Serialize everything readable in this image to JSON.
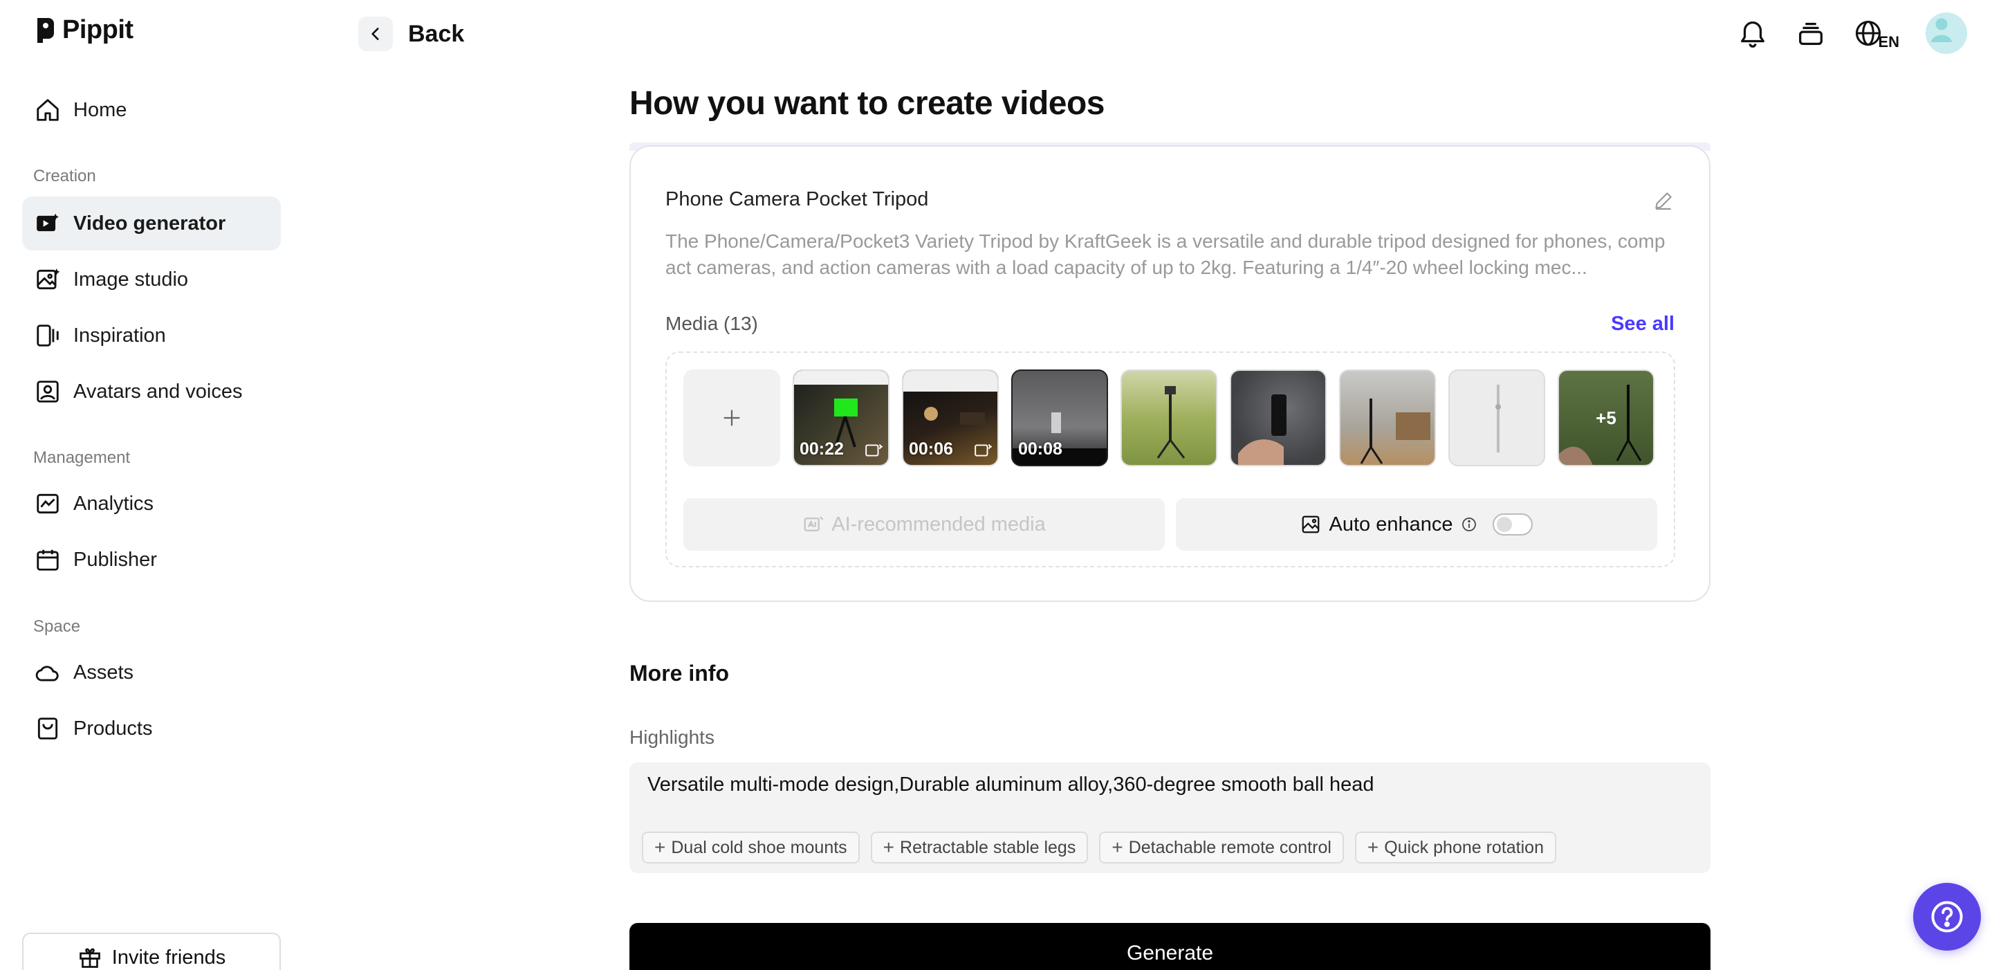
{
  "brand": {
    "name": "Pippit"
  },
  "sidebar": {
    "home": "Home",
    "sections": {
      "creation": "Creation",
      "management": "Management",
      "space": "Space"
    },
    "items": {
      "video_generator": "Video generator",
      "image_studio": "Image studio",
      "inspiration": "Inspiration",
      "avatars_voices": "Avatars and voices",
      "analytics": "Analytics",
      "publisher": "Publisher",
      "assets": "Assets",
      "products": "Products"
    },
    "invite": "Invite friends"
  },
  "topbar": {
    "back_label": "Back",
    "language": "EN"
  },
  "main": {
    "title": "How you want to create videos",
    "product": {
      "name": "Phone Camera Pocket Tripod",
      "description": "The Phone/Camera/Pocket3 Variety Tripod by KraftGeek is a versatile and durable tripod designed for phones, compact cameras, and action cameras with a load capacity of up to 2kg. Featuring a 1/4″-20 wheel locking mec..."
    },
    "media": {
      "label": "Media (13)",
      "see_all": "See all",
      "thumbs": [
        {
          "duration": "00:22"
        },
        {
          "duration": "00:06"
        },
        {
          "duration": "00:08"
        }
      ],
      "more_count": "+5",
      "ai_recommended": "AI-recommended media",
      "auto_enhance": "Auto enhance"
    },
    "more_info": "More info",
    "highlights": {
      "label": "Highlights",
      "value": "Versatile multi-mode design,Durable aluminum alloy,360-degree smooth ball head",
      "chips": [
        "Dual cold shoe mounts",
        "Retractable stable legs",
        "Detachable remote control",
        "Quick phone rotation"
      ]
    },
    "generate": "Generate"
  },
  "colors": {
    "accent": "#4a3aff",
    "help_button": "#5b45e6",
    "active_nav_bg": "#eef1f3",
    "generate_bg": "#000000"
  }
}
